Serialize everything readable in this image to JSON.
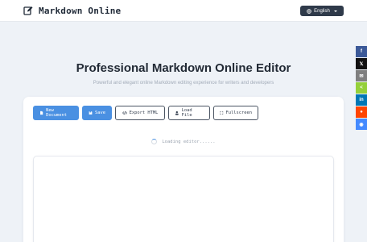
{
  "header": {
    "brand_title": "Markdown Online",
    "brand_icon": "edit-icon",
    "language_label": "English"
  },
  "hero": {
    "title": "Professional Markdown Online Editor",
    "subtitle": "Powerful and elegant online Markdown editing experience for writers and developers"
  },
  "toolbar": {
    "new_document": "New Document",
    "save": "Save",
    "export_html": "Export HTML",
    "load_file": "Load File",
    "fullscreen": "Fullscreen"
  },
  "editor": {
    "loading_text": "Loading editor......"
  },
  "share": [
    {
      "name": "facebook",
      "icon": "facebook-icon",
      "color": "#3b5998",
      "glyph": "f"
    },
    {
      "name": "x",
      "icon": "x-icon",
      "color": "#111111",
      "glyph": "𝕏"
    },
    {
      "name": "email",
      "icon": "email-icon",
      "color": "#7f7f7f",
      "glyph": "✉"
    },
    {
      "name": "sharethis",
      "icon": "share-icon",
      "color": "#95d03a",
      "glyph": "<"
    },
    {
      "name": "linkedin",
      "icon": "linkedin-icon",
      "color": "#0077b5",
      "glyph": "in"
    },
    {
      "name": "reddit",
      "icon": "reddit-icon",
      "color": "#ff4500",
      "glyph": "●"
    },
    {
      "name": "messenger",
      "icon": "messenger-icon",
      "color": "#448aff",
      "glyph": "◉"
    }
  ],
  "colors": {
    "accent": "#4a90e2",
    "dark": "#2f3a4a",
    "background": "#eef2f7"
  }
}
